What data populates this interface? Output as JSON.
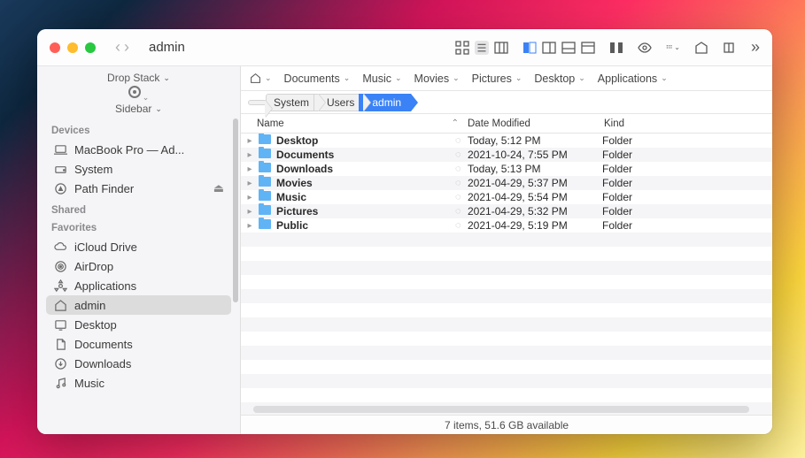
{
  "window": {
    "title": "admin"
  },
  "sidebar_top": {
    "drop_stack": "Drop Stack",
    "sidebar_label": "Sidebar"
  },
  "favbar": [
    {
      "label": "Documents"
    },
    {
      "label": "Music"
    },
    {
      "label": "Movies"
    },
    {
      "label": "Pictures"
    },
    {
      "label": "Desktop"
    },
    {
      "label": "Applications"
    }
  ],
  "breadcrumbs": [
    {
      "label": "System"
    },
    {
      "label": "Users"
    },
    {
      "label": "admin",
      "active": true
    }
  ],
  "sidebar": {
    "devices_head": "Devices",
    "devices": [
      {
        "icon": "laptop",
        "label": "MacBook Pro — Ad..."
      },
      {
        "icon": "drive",
        "label": "System"
      },
      {
        "icon": "compass",
        "label": "Path Finder",
        "eject": true
      }
    ],
    "shared_head": "Shared",
    "favorites_head": "Favorites",
    "favorites": [
      {
        "icon": "cloud",
        "label": "iCloud Drive"
      },
      {
        "icon": "airdrop",
        "label": "AirDrop"
      },
      {
        "icon": "apps",
        "label": "Applications"
      },
      {
        "icon": "home",
        "label": "admin",
        "selected": true
      },
      {
        "icon": "desktop",
        "label": "Desktop"
      },
      {
        "icon": "doc",
        "label": "Documents"
      },
      {
        "icon": "download",
        "label": "Downloads"
      },
      {
        "icon": "music",
        "label": "Music"
      }
    ]
  },
  "columns": {
    "name": "Name",
    "date": "Date Modified",
    "kind": "Kind"
  },
  "files": [
    {
      "name": "Desktop",
      "date": "Today, 5:12 PM",
      "kind": "Folder"
    },
    {
      "name": "Documents",
      "date": "2021-10-24, 7:55 PM",
      "kind": "Folder"
    },
    {
      "name": "Downloads",
      "date": "Today, 5:13 PM",
      "kind": "Folder"
    },
    {
      "name": "Movies",
      "date": "2021-04-29, 5:37 PM",
      "kind": "Folder"
    },
    {
      "name": "Music",
      "date": "2021-04-29, 5:54 PM",
      "kind": "Folder"
    },
    {
      "name": "Pictures",
      "date": "2021-04-29, 5:32 PM",
      "kind": "Folder"
    },
    {
      "name": "Public",
      "date": "2021-04-29, 5:19 PM",
      "kind": "Folder"
    }
  ],
  "status": "7 items, 51.6 GB available"
}
